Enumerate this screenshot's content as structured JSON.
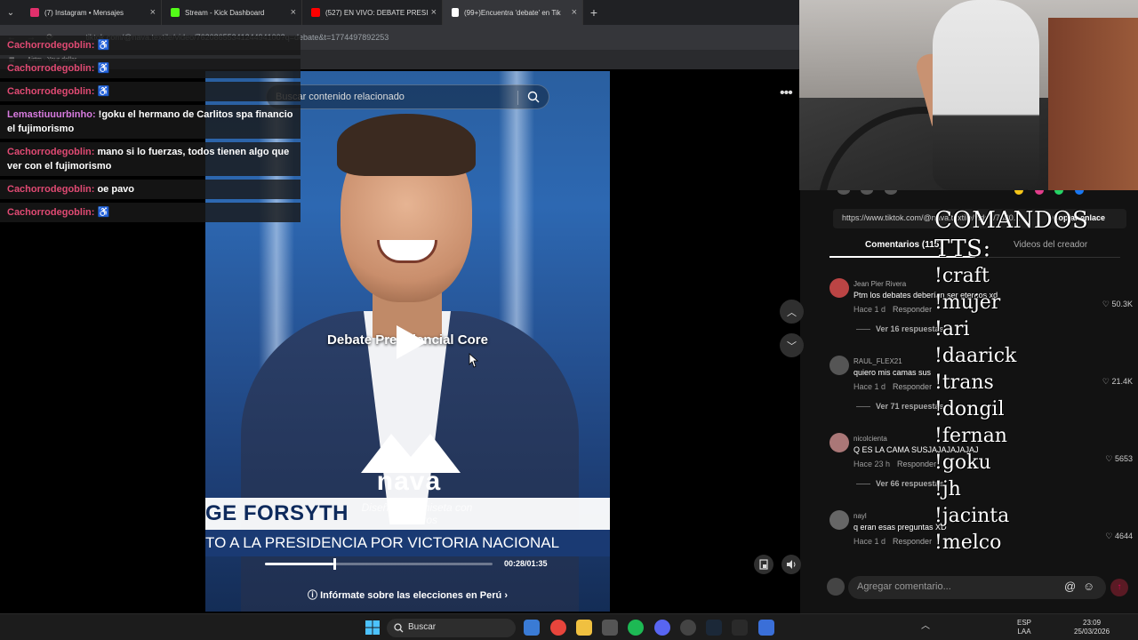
{
  "browser": {
    "tabs": [
      {
        "label": "(7) Instagram • Mensajes",
        "color": "#e1306c"
      },
      {
        "label": "Stream - Kick Dashboard",
        "color": "#53fc18"
      },
      {
        "label": "(527) EN VIVO: DEBATE PRESID",
        "color": "#ff0000"
      },
      {
        "label": "(99+)Encuentra 'debate' en Tik",
        "color": "#ffffff"
      }
    ],
    "address": "tiktok.com/@nava.textile/video/7620865534124494100?q=debate&t=1774497892253",
    "bookmark": "Airtm - Your dollar..."
  },
  "chat": [
    {
      "user": "Cachorrodegoblin:",
      "msg": "♿",
      "alt": false
    },
    {
      "user": "Cachorrodegoblin:",
      "msg": "♿",
      "alt": false
    },
    {
      "user": "Cachorrodegoblin:",
      "msg": "♿",
      "alt": false
    },
    {
      "user": "Lemastiuuurbinho:",
      "msg": "!goku el hermano de Carlitos spa financio el fujimorismo",
      "alt": true
    },
    {
      "user": "Cachorrodegoblin:",
      "msg": "mano si lo fuerzas, todos tienen algo que ver con el fujimorismo",
      "alt": false
    },
    {
      "user": "Cachorrodegoblin:",
      "msg": "oe pavo",
      "alt": false
    },
    {
      "user": "Cachorrodegoblin:",
      "msg": "♿",
      "alt": false
    }
  ],
  "video": {
    "search_placeholder": "Buscar contenido relacionado",
    "overlay_title": "Debate Presidencial Core",
    "logo_text": "nava",
    "logo_sub": "Diseña tu camiseta con nosotros",
    "lower_name": "GE FORSYTH",
    "lower_sub": "TO A LA PRESIDENCIA POR VICTORIA NACIONAL",
    "progress_fraction": 0.3,
    "time": "00:28/01:35",
    "inform": "Infórmate sobre las elecciones en Perú"
  },
  "panel": {
    "share_url": "https://www.tiktok.com/@nava.textile/video/7620...",
    "copy_label": "Copiar enlace",
    "tab_comments": "Comentarios (115)",
    "tab_creator": "Videos del creador",
    "comments": [
      {
        "name": "Jean Pier Rivera",
        "text": "Ptm los debates deberían ser eternos xd",
        "time": "Hace 1 d",
        "reply": "Responder",
        "likes": "♡ 50.3K",
        "replies": "Ver 16 respuestas",
        "color": "#b44"
      },
      {
        "name": "RAUL_FLEX21",
        "text": "quiero mis camas sus",
        "time": "Hace 1 d",
        "reply": "Responder",
        "likes": "♡ 21.4K",
        "replies": "Ver 71 respuestas",
        "color": "#555"
      },
      {
        "name": "nicolcienta",
        "text": "Q ES LA CAMA SUSJAJAJAJAJAJ",
        "time": "Hace 23 h",
        "reply": "Responder",
        "likes": "♡ 5653",
        "replies": "Ver 66 respuestas",
        "color": "#a77"
      },
      {
        "name": "nayl",
        "text": "q eran esas preguntas XD",
        "time": "Hace 1 d",
        "reply": "Responder",
        "likes": "♡ 4644",
        "replies": "",
        "color": "#666"
      }
    ],
    "comment_placeholder": "Agregar comentario..."
  },
  "commands": {
    "title": "COMANDOS TTS:",
    "items": [
      "!craft",
      "!mujer",
      "!ari",
      "!daarick",
      "!trans",
      "!dongil",
      "!fernan",
      "!goku",
      "!jh",
      "!jacinta",
      "!melco"
    ]
  },
  "taskbar": {
    "search": "Buscar",
    "lang": "ESP",
    "lang2": "LAA",
    "time": "23:09",
    "date": "25/03/2026"
  }
}
